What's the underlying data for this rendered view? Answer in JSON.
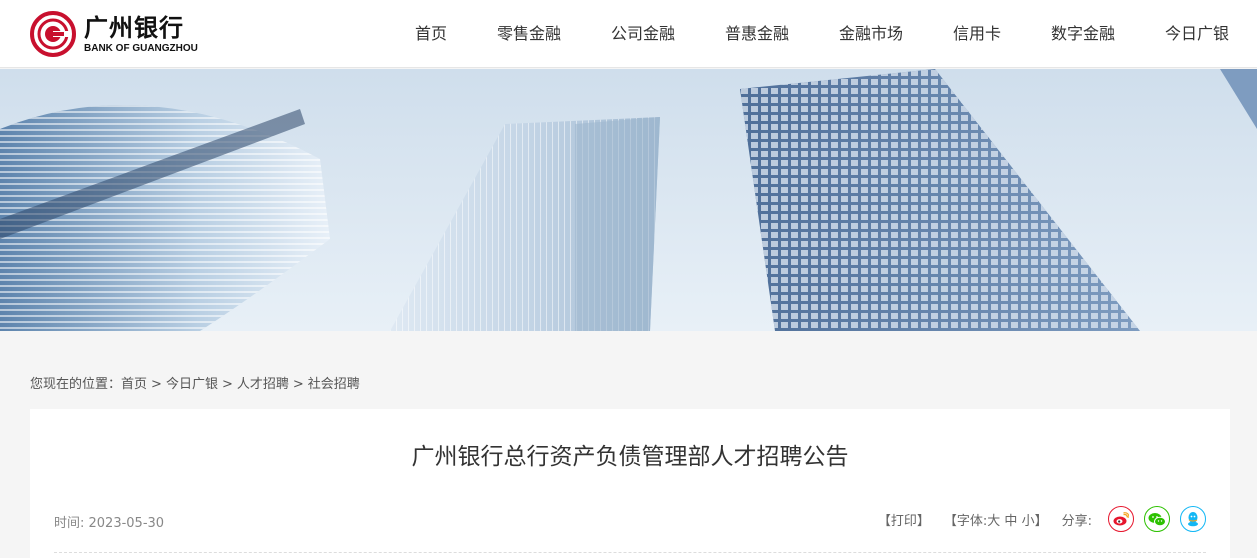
{
  "brand": {
    "name_cn": "广州银行",
    "name_en": "BANK OF GUANGZHOU",
    "color": "#c8102e"
  },
  "nav": {
    "items": [
      {
        "label": "首页"
      },
      {
        "label": "零售金融"
      },
      {
        "label": "公司金融"
      },
      {
        "label": "普惠金融"
      },
      {
        "label": "金融市场"
      },
      {
        "label": "信用卡"
      },
      {
        "label": "数字金融"
      },
      {
        "label": "今日广银"
      }
    ]
  },
  "banner": {
    "icon": "city-skyscraper-banner"
  },
  "breadcrumb": {
    "prefix": "您现在的位置：",
    "items": [
      {
        "label": "首页"
      },
      {
        "label": "今日广银"
      },
      {
        "label": "人才招聘"
      },
      {
        "label": "社会招聘"
      }
    ],
    "separator": ">"
  },
  "article": {
    "title": "广州银行总行资产负债管理部人才招聘公告",
    "date_label": "时间: 2023-05-30",
    "print_label": "【打印】",
    "font_prefix": "【字体:",
    "font_large": "大",
    "font_medium": "中",
    "font_small": "小",
    "font_suffix": "】",
    "share_label": "分享:"
  },
  "share": {
    "weibo_color": "#e6162d",
    "wechat_color": "#2dc100",
    "qq_color": "#12b7f5"
  }
}
